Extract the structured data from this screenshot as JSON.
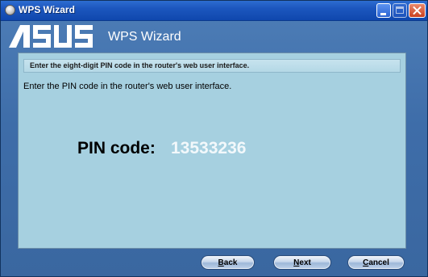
{
  "window": {
    "title": "WPS Wizard",
    "app_icon": "wps-disc-icon"
  },
  "title_controls": [
    "minimize-icon",
    "maximize-icon",
    "close-icon"
  ],
  "header": {
    "logo_text": "ASUS",
    "title": "WPS Wizard"
  },
  "panel": {
    "instruction": "Enter the eight-digit PIN code in the router's web user interface.",
    "subtitle": "Enter the PIN code in the router's web user interface.",
    "pin_label": "PIN code:",
    "pin_value": "13533236"
  },
  "buttons": {
    "back": {
      "access_key": "B",
      "rest": "ack"
    },
    "next": {
      "access_key": "N",
      "rest": "ext"
    },
    "cancel": {
      "access_key": "C",
      "rest": "ancel"
    }
  },
  "colors": {
    "panel_background": "#a6d0e0",
    "title_bar": "#1c56be",
    "close_button": "#c9401f",
    "pin_value": "#f2f8fb"
  }
}
